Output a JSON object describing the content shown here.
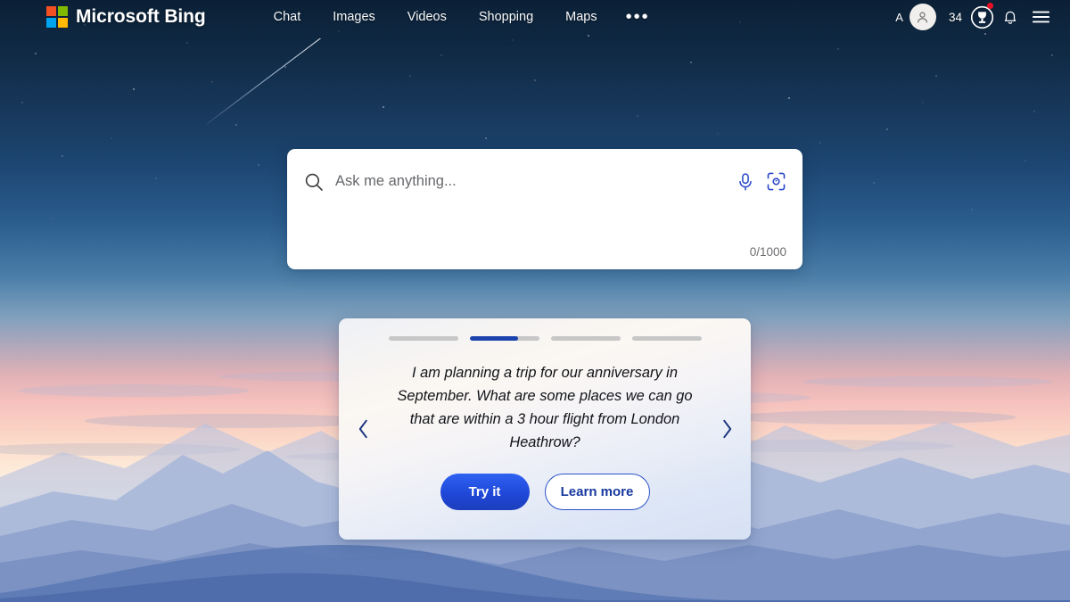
{
  "header": {
    "brand": "Microsoft Bing",
    "logo_colors": [
      "#f25022",
      "#7fba00",
      "#00a4ef",
      "#ffb900"
    ],
    "nav": [
      {
        "label": "Chat",
        "name": "nav-item-chat"
      },
      {
        "label": "Images",
        "name": "nav-item-images"
      },
      {
        "label": "Videos",
        "name": "nav-item-videos"
      },
      {
        "label": "Shopping",
        "name": "nav-item-shopping"
      },
      {
        "label": "Maps",
        "name": "nav-item-maps"
      }
    ],
    "more_label": "•••",
    "account_letter": "A",
    "rewards_points": "34",
    "rewards_badge_color": "#e81123"
  },
  "search": {
    "placeholder": "Ask me anything...",
    "value": "",
    "counter": "0/1000",
    "accent_color": "#2b4acb"
  },
  "carousel": {
    "progress": [
      {
        "fill_percent": 0
      },
      {
        "fill_percent": 70
      },
      {
        "fill_percent": 0
      },
      {
        "fill_percent": 0
      }
    ],
    "active_color": "#1c43ad",
    "track_color": "#c7c7c7",
    "prompt": "I am planning a trip for our anniversary in September. What are some places we can go that are within a 3 hour flight from London Heathrow?",
    "primary_button": "Try it",
    "secondary_button": "Learn more",
    "prev_label": "‹",
    "next_label": "›"
  }
}
